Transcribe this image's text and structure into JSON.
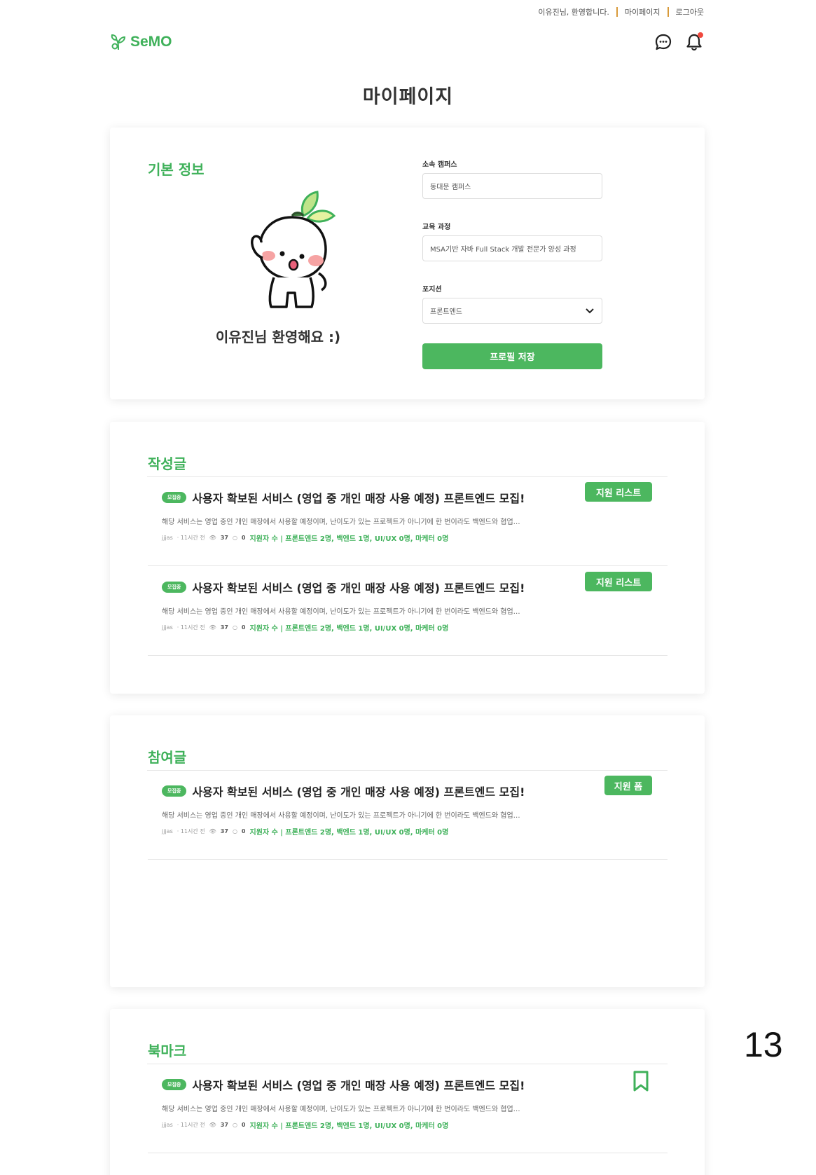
{
  "topbar": {
    "greeting": "이유진님, 환영합니다.",
    "mypage": "마이페이지",
    "logout": "로그아웃"
  },
  "header": {
    "logo_text": "SeMO",
    "logo_icon": "sprout-icon",
    "chat_icon": "chat-bubble-icon",
    "bell_icon": "bell-icon"
  },
  "page_title": "마이페이지",
  "profile": {
    "section_title": "기본 정보",
    "welcome": "이유진님 환영해요 :)",
    "campus_label": "소속 캠퍼스",
    "campus_value": "동대문 캠퍼스",
    "course_label": "교육 과정",
    "course_value": "MSA기반 자바 Full Stack 개발 전문가 양성 과정",
    "position_label": "포지션",
    "position_value": "프론트엔드",
    "save_label": "프로필 저장"
  },
  "written": {
    "section_title": "작성글",
    "posts": [
      {
        "badge": "모집중",
        "title": "사용자 확보된 서비스 (영업 중 개인 매장 사용 예정) 프론트엔드 모집!",
        "desc": "해당 서비스는 영업 중인 개인 매장에서 사용할 예정이며, 난이도가 있는 프로젝트가 아니기에 한 번이라도 백엔드와 협업…",
        "author": "jjjas",
        "time": "· 11시간 전",
        "views": "37",
        "comments": "0",
        "apply_info": "지원자 수 | 프론트엔드 2명, 백엔드 1명, UI/UX 0명, 마케터 0명",
        "action": "지원 리스트"
      },
      {
        "badge": "모집중",
        "title": "사용자 확보된 서비스 (영업 중 개인 매장 사용 예정) 프론트엔드 모집!",
        "desc": "해당 서비스는 영업 중인 개인 매장에서 사용할 예정이며, 난이도가 있는 프로젝트가 아니기에 한 번이라도 백엔드와 협업…",
        "author": "jjjas",
        "time": "· 11시간 전",
        "views": "37",
        "comments": "0",
        "apply_info": "지원자 수 | 프론트엔드 2명, 백엔드 1명, UI/UX 0명, 마케터 0명",
        "action": "지원 리스트"
      }
    ]
  },
  "joined": {
    "section_title": "참여글",
    "posts": [
      {
        "badge": "모집중",
        "title": "사용자 확보된 서비스 (영업 중 개인 매장 사용 예정) 프론트엔드 모집!",
        "desc": "해당 서비스는 영업 중인 개인 매장에서 사용할 예정이며, 난이도가 있는 프로젝트가 아니기에 한 번이라도 백엔드와 협업…",
        "author": "jjjas",
        "time": "· 11시간 전",
        "views": "37",
        "comments": "0",
        "apply_info": "지원자 수 | 프론트엔드 2명, 백엔드 1명, UI/UX 0명, 마케터 0명",
        "action": "지원 폼"
      }
    ]
  },
  "bookmark": {
    "section_title": "북마크",
    "posts": [
      {
        "badge": "모집중",
        "title": "사용자 확보된 서비스 (영업 중 개인 매장 사용 예정) 프론트엔드 모집!",
        "desc": "해당 서비스는 영업 중인 개인 매장에서 사용할 예정이며, 난이도가 있는 프로젝트가 아니기에 한 번이라도 백엔드와 협업…",
        "author": "jjjas",
        "time": "· 11시간 전",
        "views": "37",
        "comments": "0",
        "apply_info": "지원자 수 | 프론트엔드 2명, 백엔드 1명, UI/UX 0명, 마케터 0명",
        "icon": "bookmark-icon"
      }
    ]
  },
  "page_number": "13",
  "colors": {
    "accent": "#4cb75f",
    "brand": "#3fb15a",
    "notification": "#f0493e",
    "separator": "#d89a3a"
  }
}
